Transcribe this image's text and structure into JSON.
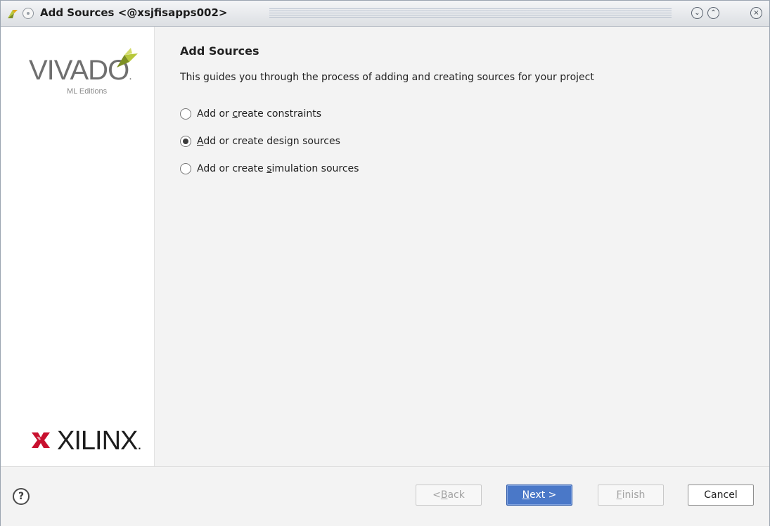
{
  "window": {
    "title": "Add Sources <@xsjfisapps002>"
  },
  "sidebar": {
    "brand_top": "VIVADO",
    "brand_top_suffix": ".",
    "brand_sub": "ML Editions",
    "brand_bottom": "XILINX",
    "brand_bottom_suffix": "."
  },
  "main": {
    "heading": "Add Sources",
    "description": "This guides you through the process of adding and creating sources for your project",
    "options": [
      {
        "pre": "Add or ",
        "key": "c",
        "post": "reate constraints",
        "selected": false
      },
      {
        "pre": "",
        "key": "A",
        "post": "dd or create design sources",
        "selected": true
      },
      {
        "pre": "Add or create ",
        "key": "s",
        "post": "imulation sources",
        "selected": false
      }
    ]
  },
  "footer": {
    "help_glyph": "?",
    "back": {
      "pre": "< ",
      "key": "B",
      "post": "ack",
      "enabled": false
    },
    "next": {
      "pre": "",
      "key": "N",
      "post": "ext >",
      "enabled": true
    },
    "finish": {
      "pre": "",
      "key": "F",
      "post": "inish",
      "enabled": false
    },
    "cancel": {
      "label": "Cancel",
      "enabled": true
    }
  },
  "colors": {
    "primary_button": "#4a78c8",
    "vivado_leaf": "#b7c83c",
    "xilinx_red": "#c8102e"
  },
  "icons": {
    "app": "vivado-app-icon",
    "window_menu": "window-menu-icon",
    "minimize": "minimize-icon",
    "maximize": "maximize-icon",
    "close": "close-icon",
    "help": "help-icon"
  }
}
